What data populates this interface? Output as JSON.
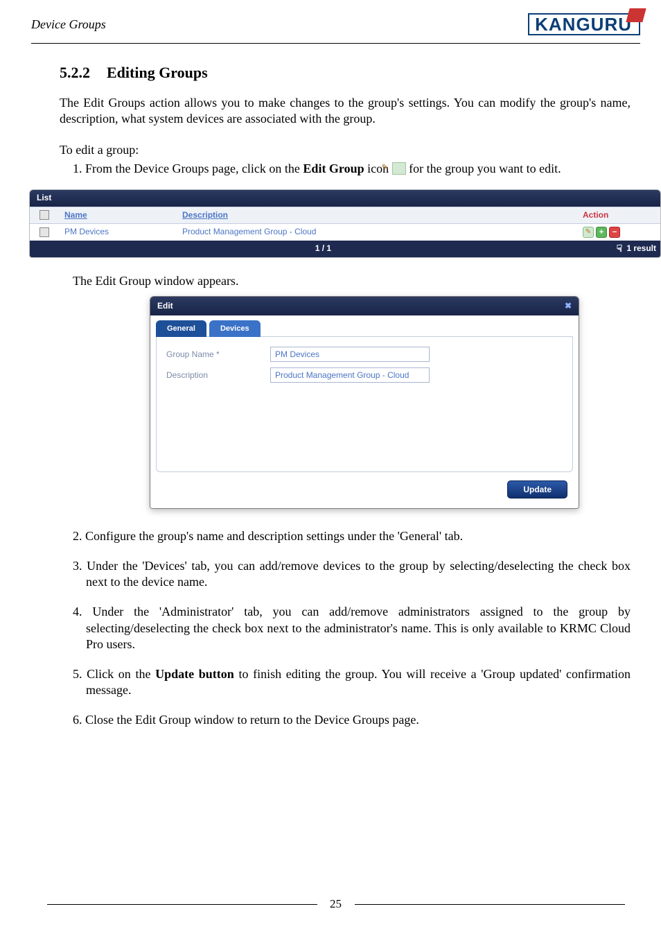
{
  "header": {
    "section_title": "Device Groups",
    "brand": "KANGURU"
  },
  "heading": {
    "number": "5.2.2",
    "title": "Editing Groups"
  },
  "body": {
    "intro": "The Edit Groups action allows you to make changes to the group's settings. You can modify the group's name, description, what system devices are associated with the group.",
    "lead": "To edit a group:",
    "step1_a": "1.  From the Device Groups page, click on the ",
    "step1_bold": "Edit Group",
    "step1_b": " icon ",
    "step1_c": " for the group you want to edit.",
    "after_list": "The Edit Group window appears.",
    "step2": "2.  Configure the group's name and description settings under the 'General' tab.",
    "step3": "3.  Under the 'Devices' tab, you can add/remove devices to the group by selecting/deselecting the check box next to the device name.",
    "step4": "4.  Under the 'Administrator' tab, you can add/remove administrators assigned to the group by selecting/deselecting the check box next to the administrator's name. This is only available to KRMC Cloud Pro users.",
    "step5_a": "5.  Click on the ",
    "step5_bold": "Update button",
    "step5_b": " to finish editing the group. You will receive a 'Group updated' confirmation message.",
    "step6": "6.  Close the Edit Group window to return to the Device Groups page."
  },
  "list_tbl": {
    "title": "List",
    "head_name": "Name",
    "head_desc": "Description",
    "head_action": "Action",
    "row_name": "PM Devices",
    "row_desc": "Product Management Group - Cloud",
    "pager": "1 / 1",
    "result": "1 result"
  },
  "dialog": {
    "title": "Edit",
    "close": "✖",
    "tab_general": "General",
    "tab_devices": "Devices",
    "label_group_name": "Group Name *",
    "label_description": "Description",
    "val_group_name": "PM Devices",
    "val_description": "Product Management Group - Cloud",
    "update_btn": "Update"
  },
  "footer": {
    "page_num": "25"
  }
}
